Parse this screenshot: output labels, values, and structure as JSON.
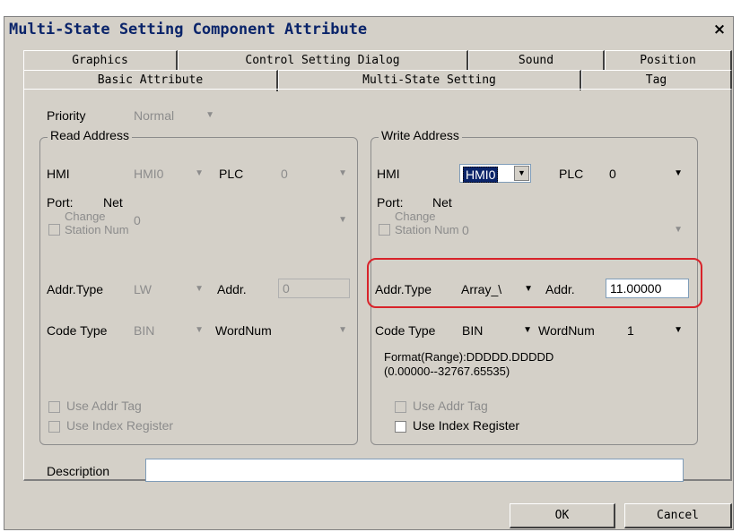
{
  "window": {
    "title": "Multi-State Setting Component Attribute",
    "close": "×"
  },
  "tabs_row1": [
    "Graphics",
    "Control Setting Dialog",
    "Sound",
    "Position"
  ],
  "tabs_row2": [
    "Basic Attribute",
    "Multi-State Setting",
    "Tag"
  ],
  "priority": {
    "label": "Priority",
    "value": "Normal"
  },
  "read": {
    "title": "Read Address",
    "hmi_label": "HMI",
    "hmi_value": "HMI0",
    "plc_label": "PLC",
    "plc_value": "0",
    "port_label": "Port:",
    "port_value": "Net",
    "change_label_1": "Change",
    "change_label_2": "Station Num",
    "station_value": "0",
    "addr_type_label": "Addr.Type",
    "addr_type_value": "LW",
    "addr_label": "Addr.",
    "addr_value": "0",
    "code_type_label": "Code Type",
    "code_type_value": "BIN",
    "wordnum_label": "WordNum",
    "wordnum_value": "",
    "use_addr_tag": "Use Addr Tag",
    "use_index_reg": "Use Index Register"
  },
  "write": {
    "title": "Write Address",
    "hmi_label": "HMI",
    "hmi_value": "HMI0",
    "plc_label": "PLC",
    "plc_value": "0",
    "port_label": "Port:",
    "port_value": "Net",
    "change_label_1": "Change",
    "change_label_2": "Station Num",
    "station_value": "0",
    "addr_type_label": "Addr.Type",
    "addr_type_value": "Array_\\",
    "addr_label": "Addr.",
    "addr_value": "11.00000",
    "code_type_label": "Code Type",
    "code_type_value": "BIN",
    "wordnum_label": "WordNum",
    "wordnum_value": "1",
    "format_line1": "Format(Range):DDDDD.DDDDD",
    "format_line2": "(0.00000--32767.65535)",
    "use_addr_tag": "Use Addr Tag",
    "use_index_reg": "Use Index Register"
  },
  "description": {
    "label": "Description",
    "value": ""
  },
  "buttons": {
    "ok": "OK",
    "cancel": "Cancel"
  },
  "colors": {
    "highlight": "#d8232a",
    "title": "#0a246a",
    "dialog_bg": "#d4d0c8"
  }
}
